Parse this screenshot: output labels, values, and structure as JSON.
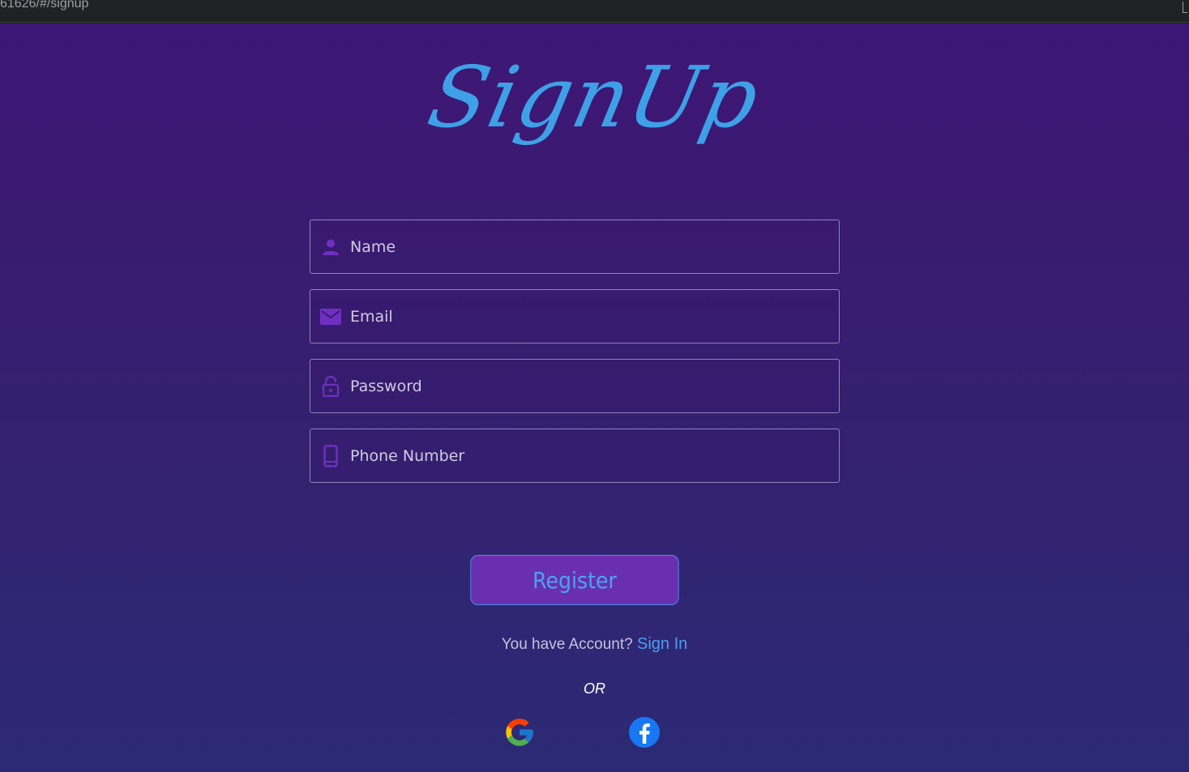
{
  "browser": {
    "url": "61626/#/signup"
  },
  "page": {
    "title": "SignUp",
    "fields": [
      {
        "name": "name",
        "placeholder": "Name",
        "icon": "person-icon"
      },
      {
        "name": "email",
        "placeholder": "Email",
        "icon": "mail-icon"
      },
      {
        "name": "password",
        "placeholder": "Password",
        "icon": "lock-icon"
      },
      {
        "name": "phone",
        "placeholder": "Phone Number",
        "icon": "phone-icon"
      }
    ],
    "register_label": "Register",
    "account_prompt": "You have Account?",
    "signin_label": "Sign In",
    "or_label": "OR",
    "social": [
      "google-icon",
      "facebook-icon"
    ]
  },
  "colors": {
    "accent": "#3ea0e6",
    "button_bg": "#6a2fb0",
    "icon_purple": "#6f2fc0",
    "link": "#4a9ef0"
  }
}
